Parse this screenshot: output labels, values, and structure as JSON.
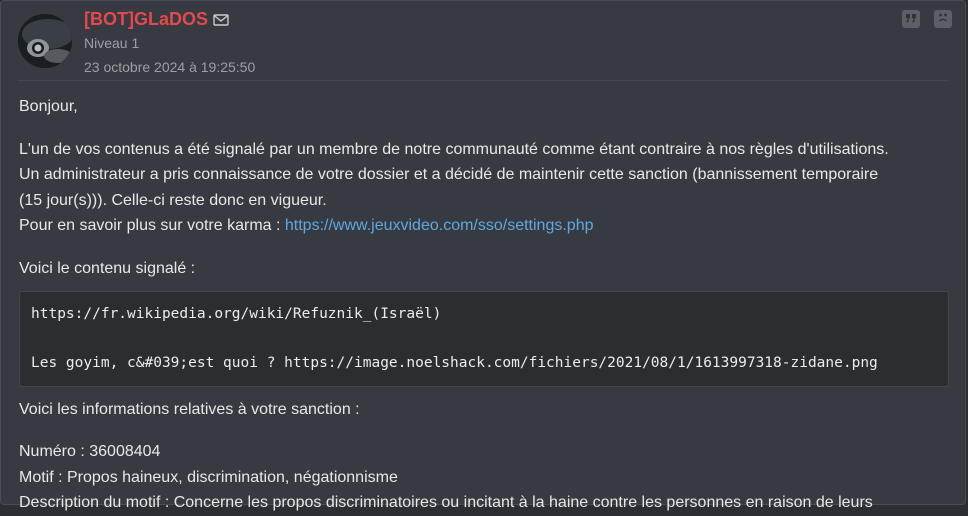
{
  "post": {
    "author": "[BOT]GLaDOS",
    "level": "Niveau 1",
    "date": "23 octobre 2024 à 19:25:50"
  },
  "message": {
    "greeting": "Bonjour,",
    "para1_line1": "L'un de vos contenus a été signalé par un membre de notre communauté comme étant contraire à nos règles d'utilisations.",
    "para1_line2": "Un administrateur a pris connaissance de votre dossier et a décidé de maintenir cette sanction (bannissement temporaire",
    "para1_line3": "(15 jour(s))). Celle-ci reste donc en vigueur.",
    "para1_line4_prefix": "Pour en savoir plus sur votre karma : ",
    "karma_link": "https://www.jeuxvideo.com/sso/settings.php",
    "reported_intro": "Voici le contenu signalé :",
    "code_line1": "https://fr.wikipedia.org/wiki/Refuznik_(Israël)",
    "code_line2": "Les goyim, c&#039;est quoi ? https://image.noelshack.com/fichiers/2021/08/1/1613997318-zidane.png",
    "sanction_intro": "Voici les informations relatives à votre sanction :",
    "numero": "Numéro : 36008404",
    "motif": "Motif : Propos haineux, discrimination, négationnisme",
    "description": "Description du motif : Concerne les propos discriminatoires ou incitant à la haine contre les personnes en raison de leurs"
  },
  "colors": {
    "background": "#373a40",
    "author": "#e3494e",
    "link": "#5fa8e3",
    "meta": "#9aa0a6"
  },
  "icons": {
    "mail": "envelope-icon",
    "quote": "quote-icon",
    "report": "sad-face-icon"
  }
}
